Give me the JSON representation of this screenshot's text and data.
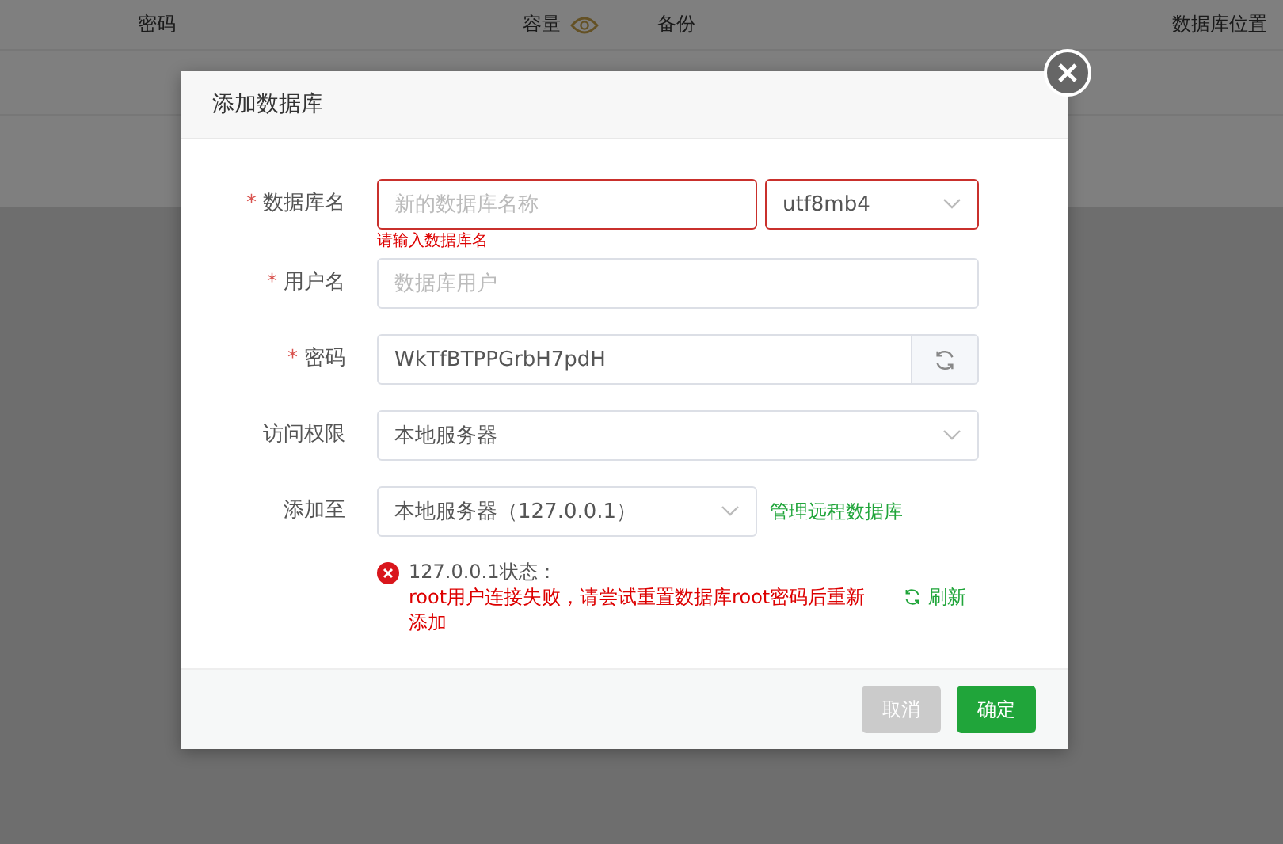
{
  "table": {
    "columns": [
      {
        "label": "密码",
        "kind": "plain"
      },
      {
        "label": "容量",
        "kind": "with-icon"
      },
      {
        "label": "备份",
        "kind": "plain"
      },
      {
        "label": "数据库位置",
        "kind": "plain"
      }
    ]
  },
  "dialog": {
    "title": "添加数据库",
    "fields": [
      {
        "kind": "text-with-select",
        "label": "数据库名",
        "required_mark": "*",
        "placeholder": "新的数据库名称",
        "select_value": "utf8mb4",
        "invalid": true,
        "error": "请输入数据库名"
      },
      {
        "kind": "text",
        "label": "用户名",
        "required_mark": "*",
        "placeholder": "数据库用户",
        "invalid": false
      },
      {
        "kind": "password",
        "label": "密码",
        "required_mark": "*",
        "value": "WkTfBTPPGrbH7pdH",
        "invalid": false
      },
      {
        "kind": "select",
        "label": "访问权限",
        "value": "本地服务器",
        "invalid": false
      },
      {
        "kind": "select-link",
        "label": "添加至",
        "value": "本地服务器（127.0.0.1）",
        "link": "管理远程数据库",
        "invalid": false
      }
    ],
    "status": {
      "title": "127.0.0.1状态：",
      "message": "root用户连接失败，请尝试重置数据库root密码后重新添加",
      "refresh": "刷新"
    },
    "buttons": [
      {
        "label": "取消",
        "kind": "cancel",
        "disabled": true
      },
      {
        "label": "确定",
        "kind": "confirm",
        "disabled": false
      }
    ]
  }
}
